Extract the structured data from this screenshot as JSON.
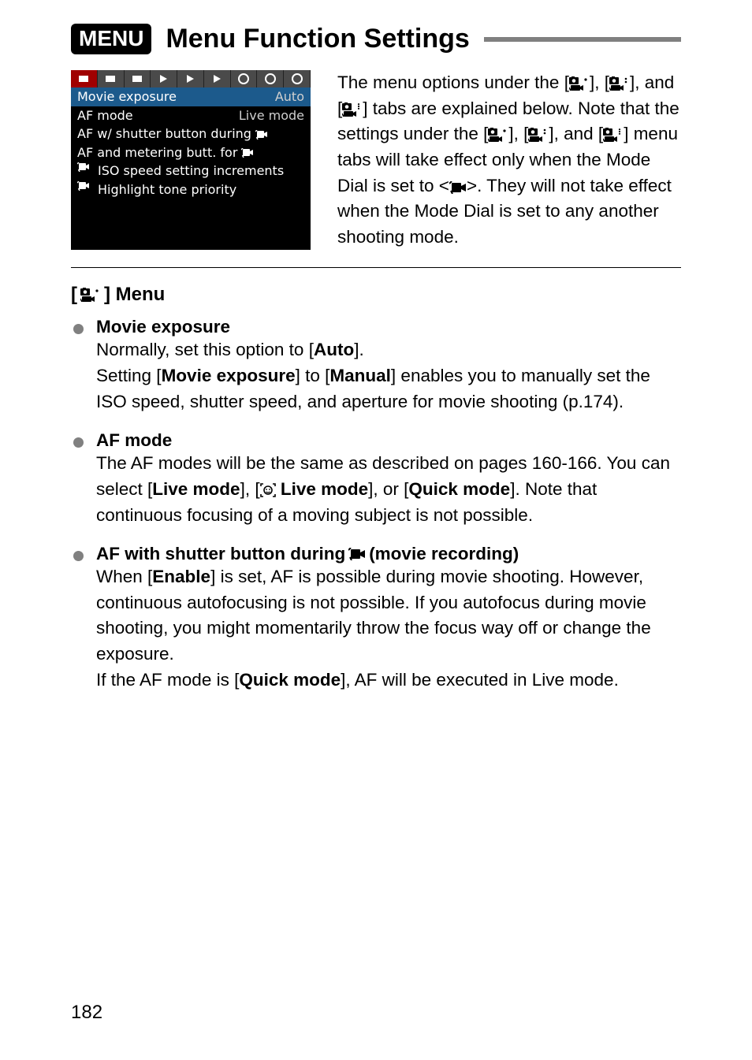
{
  "heading": {
    "pill": "MENU",
    "title": "Menu Function Settings"
  },
  "lcd": {
    "rows": [
      {
        "label": "Movie exposure",
        "value": "Auto",
        "selected": true
      },
      {
        "label": "AF mode",
        "value": "Live mode"
      },
      {
        "label": "AF w/ shutter button during",
        "movie_icon": true
      },
      {
        "label": "AF and metering butt. for",
        "movie_icon": true
      },
      {
        "movie_prefix": true,
        "label": "ISO speed setting increments"
      },
      {
        "movie_prefix": true,
        "label": "Highlight tone priority"
      }
    ]
  },
  "intro": {
    "p1a": "The menu options under the [",
    "p1b": "], [",
    "p1c": "], and [",
    "p1d": "] tabs are explained below. Note that the settings under the [",
    "p1e": "], [",
    "p1f": "], and [",
    "p1g": "] menu tabs will take effect only when the Mode Dial is set to <",
    "p1h": ">. They will not take effect when the Mode Dial is set to any another shooting mode."
  },
  "section_title_open": "[",
  "section_title_close": "] Menu",
  "items": [
    {
      "title": "Movie exposure",
      "body_parts": [
        "Normally, set this option to [",
        {
          "b": "Auto"
        },
        "].",
        {
          "br": true
        },
        "Setting [",
        {
          "b": "Movie exposure"
        },
        "] to [",
        {
          "b": "Manual"
        },
        "] enables you to manually set the ISO speed, shutter speed, and aperture for movie shooting (p.174)."
      ]
    },
    {
      "title": "AF mode",
      "body_parts": [
        "The AF modes will be the same as described on pages 160-166. You can select [",
        {
          "b": "Live mode"
        },
        "], [",
        {
          "icon": "face"
        },
        " ",
        {
          "b": "Live mode"
        },
        "], or [",
        {
          "b": "Quick mode"
        },
        "]. Note that continuous focusing of a moving subject is not possible."
      ]
    },
    {
      "title_parts": [
        "AF with shutter button during ",
        {
          "icon": "movie-black"
        },
        " (movie recording)"
      ],
      "body_parts": [
        "When [",
        {
          "b": "Enable"
        },
        "] is set, AF is possible during movie shooting. However, continuous autofocusing is not possible. If you autofocus during movie shooting, you might momentarily throw the focus way off or change the exposure.",
        {
          "br": true
        },
        "If the AF mode is [",
        {
          "b": "Quick mode"
        },
        "], AF will be executed in Live mode."
      ]
    }
  ],
  "page_number": "182"
}
